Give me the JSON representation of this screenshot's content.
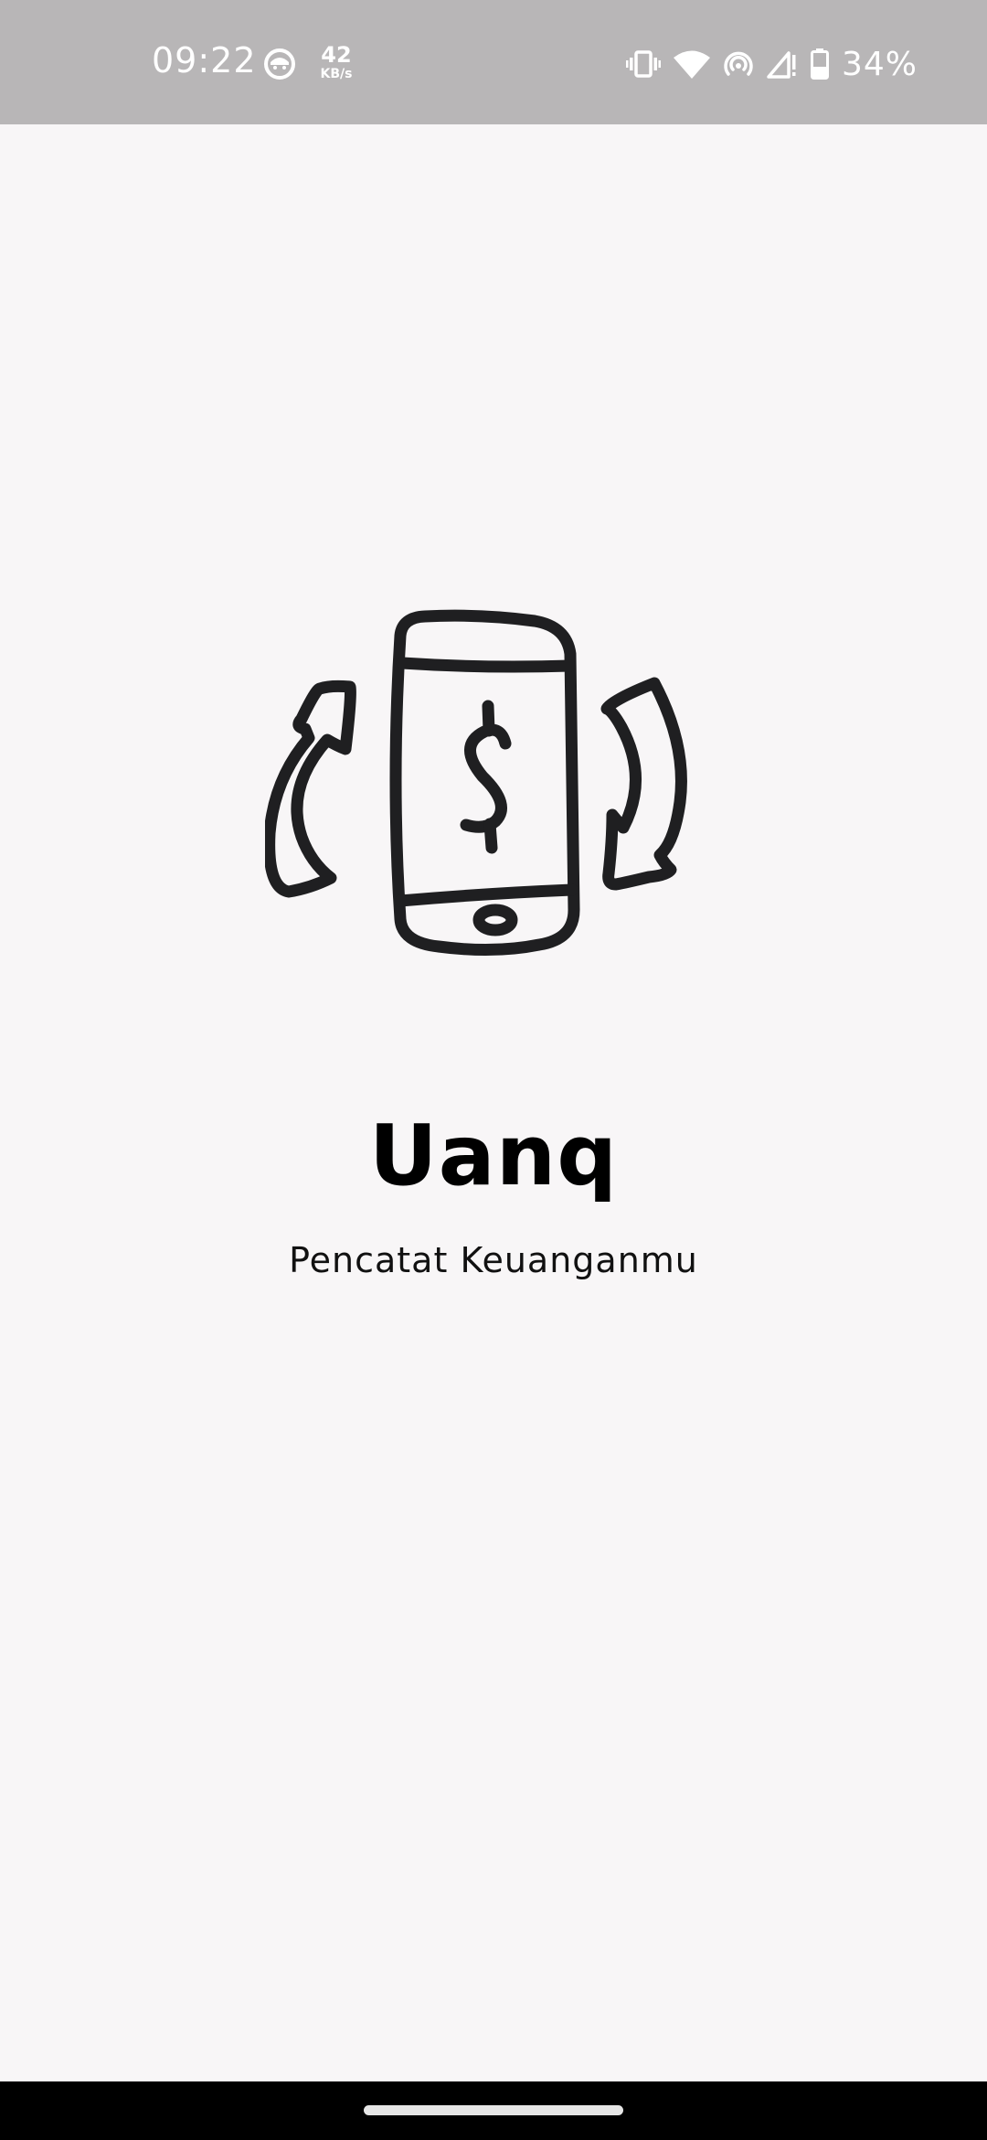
{
  "status_bar": {
    "time": "09:22",
    "network_speed_value": "42",
    "network_speed_unit": "KB/s",
    "battery_percent": "34%",
    "icons": [
      "face-icon",
      "vibrate-icon",
      "wifi-icon",
      "hotspot-icon",
      "cell-signal-icon",
      "battery-icon"
    ],
    "background_color": "#b8b6b7"
  },
  "splash": {
    "logo_icon": "phone-dollar-rotate-icon",
    "title": "Uanq",
    "subtitle": "Pencatat Keuanganmu",
    "background_color": "#f8f6f7"
  },
  "nav_bar": {
    "background_color": "#000000"
  }
}
